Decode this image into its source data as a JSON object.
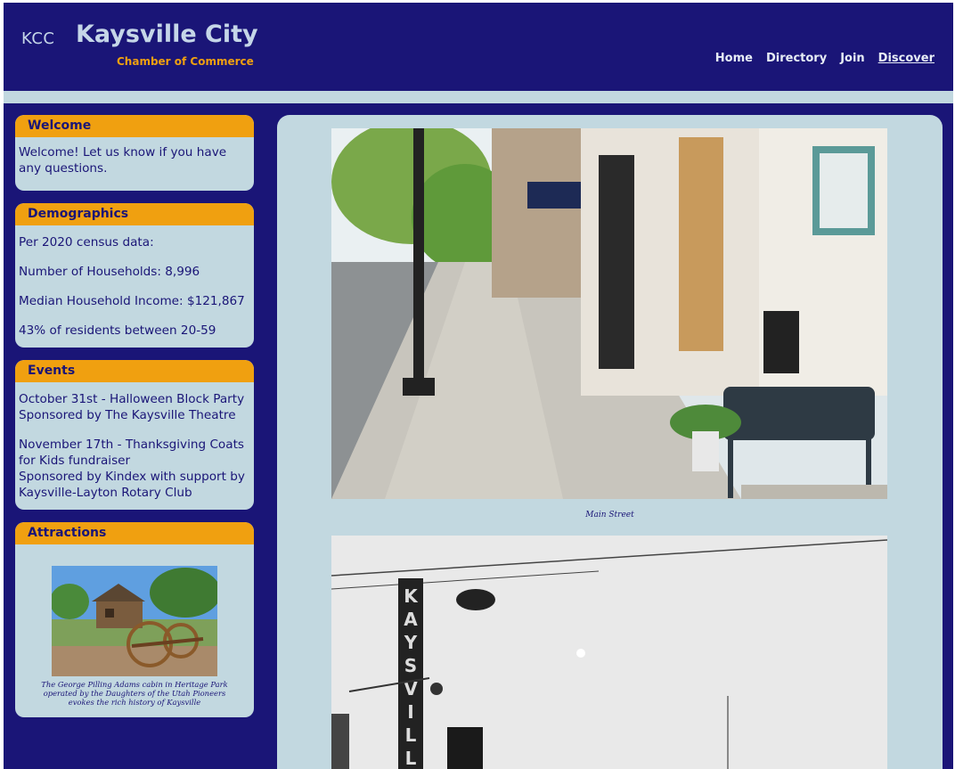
{
  "header": {
    "logo": "KCC",
    "title": "Kaysville City",
    "subtitle": "Chamber of Commerce",
    "nav": [
      {
        "label": "Home",
        "active": false
      },
      {
        "label": "Directory",
        "active": false
      },
      {
        "label": "Join",
        "active": false
      },
      {
        "label": "Discover",
        "active": true
      }
    ]
  },
  "colors": {
    "navy": "#1a1577",
    "orange": "#f0a010",
    "light_blue": "#c2d8e0"
  },
  "sidebar": {
    "welcome": {
      "title": "Welcome",
      "text": "Welcome! Let us know if you have any questions."
    },
    "demographics": {
      "title": "Demographics",
      "lines": [
        "Per 2020 census data:",
        "Number of Households: 8,996",
        "Median Household Income: $121,867",
        "43% of residents between 20-59"
      ]
    },
    "events": {
      "title": "Events",
      "items": [
        "October 31st - Halloween Block Party\nSponsored by The Kaysville Theatre",
        "November 17th - Thanksgiving Coats for Kids fundraiser\nSponsored by Kindex with support by Kaysville-Layton Rotary Club"
      ]
    },
    "attractions": {
      "title": "Attractions",
      "caption": "The George Pilling Adams cabin in Heritage Park operated by the Daughters of the Utah Pioneers evokes the rich history of Kaysville"
    }
  },
  "main": {
    "photo_caption": "Main Street",
    "sign_text": "KAYSVILLE"
  }
}
